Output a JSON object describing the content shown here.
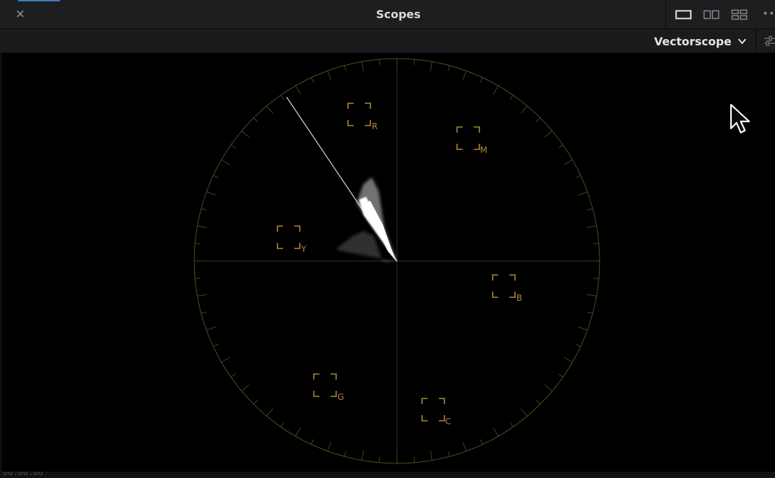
{
  "window": {
    "title": "Scopes",
    "close_icon": "close-icon",
    "layout_buttons": [
      {
        "icon": "single-view-icon",
        "active": true
      },
      {
        "icon": "dual-view-icon",
        "active": false
      },
      {
        "icon": "quad-view-icon",
        "active": false
      }
    ],
    "more_icon": "more-options-icon"
  },
  "toolbar": {
    "scope_type": "Vectorscope",
    "dropdown_icon": "chevron-down-icon",
    "settings_icon": "scope-settings-icon"
  },
  "vectorscope": {
    "targets": [
      {
        "label": "R"
      },
      {
        "label": "M"
      },
      {
        "label": "Y"
      },
      {
        "label": "B"
      },
      {
        "label": "G"
      },
      {
        "label": "C"
      }
    ],
    "graticule_color": "#7a6636",
    "target_color": "#b08a38",
    "trace_color": "#ffffff",
    "skin_tone_line": true
  },
  "status": {
    "timecode": "00:00:00"
  }
}
